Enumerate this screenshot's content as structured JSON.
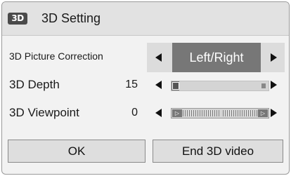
{
  "header": {
    "logo_text": "3D",
    "title": "3D Setting"
  },
  "picture_correction": {
    "label": "3D Picture Correction",
    "value": "Left/Right"
  },
  "depth": {
    "label": "3D Depth",
    "value": "15",
    "level_fraction": 0.08
  },
  "viewpoint": {
    "label": "3D Viewpoint",
    "value": "0"
  },
  "buttons": {
    "ok": "OK",
    "end": "End 3D video"
  }
}
